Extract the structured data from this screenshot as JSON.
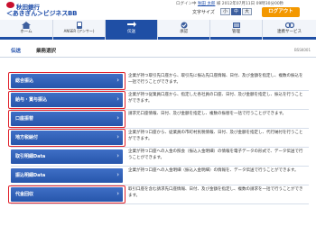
{
  "header": {
    "bank_name": "秋田銀行",
    "service_name": "＜あきぎん＞ビジネスBB",
    "user_prefix": "ログイン中",
    "user_name": "秋田 太郎",
    "user_suffix": "様 2012年07月11日 09時30分00秒",
    "font_size_label": "文字サイズ",
    "font_small": "小",
    "font_medium": "中",
    "font_large": "大",
    "logout_label": "ログアウト"
  },
  "nav": {
    "items": [
      {
        "label": "ホーム",
        "icon": "home-icon",
        "active": false
      },
      {
        "label": "ANSER\n(アンサー)",
        "icon": "anser-icon",
        "active": false
      },
      {
        "label": "伝送",
        "icon": "transmission-icon",
        "active": true
      },
      {
        "label": "承認",
        "icon": "approval-icon",
        "active": false
      },
      {
        "label": "管理",
        "icon": "management-icon",
        "active": false
      },
      {
        "label": "連携サービス",
        "icon": "link-service-icon",
        "active": false
      }
    ]
  },
  "page": {
    "section_label": "伝送",
    "title": "業務選択",
    "screen_code": "BSSK001"
  },
  "menu": [
    {
      "label": "総合振込",
      "desc": "企業が持つ取引先口座から、取引先に振込先口座情報、日付、及び金額を指定し、複数の振込を一括で行うことができます。",
      "highlight": true
    },
    {
      "label": "給与・賞与振込",
      "desc": "企業が持つ従業員口座から、指定した各社員の口座、日付、及び金額を指定し、振込を行うことができます。",
      "highlight": true
    },
    {
      "label": "口座振替",
      "desc": "請求元口座情報、日付、及び金額を指定し、複数の振替を一括で行うことができます。",
      "highlight": true
    },
    {
      "label": "地方税納付",
      "desc": "企業が持つ口座から、従業員の市町村民税情報、日付、及び金額を指定し、代行納付を行うことができます。",
      "highlight": true
    },
    {
      "label": "取引明細Data",
      "desc": "企業が持つ口座への入金の照会（振込入金明細）の情報を電子データの形式で、データ伝送で行うことができます。",
      "highlight": false
    },
    {
      "label": "振込明細Data",
      "desc": "企業が持つ口座への入金明細（振込入金明細）の情報を、データ伝送で行うことができます。",
      "highlight": false
    },
    {
      "label": "代金回収",
      "desc": "取引口座を含む請求先口座情報、日付、及び金額を指定し、複数の請求を一括で行うことができます。",
      "highlight": true
    }
  ],
  "colors": {
    "brand": "#1f4fa5",
    "menu_button": "#2f5fb8",
    "highlight": "#e0202a",
    "logout": "#f39800"
  }
}
